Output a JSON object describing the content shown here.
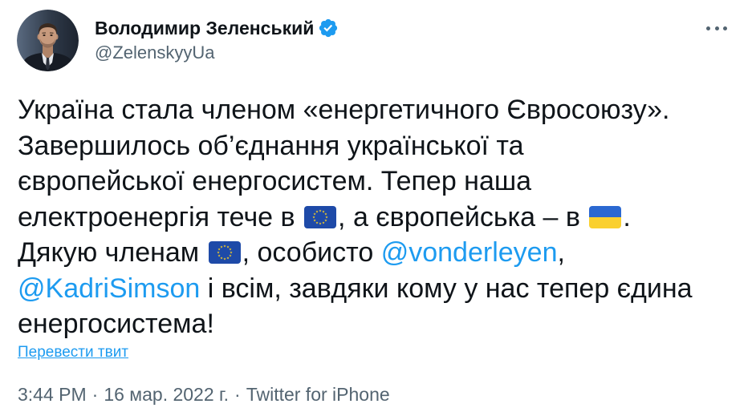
{
  "author": {
    "name": "Володимир Зеленський",
    "handle": "@ZelenskyyUa",
    "avatar_icon": "avatar-photo",
    "verified_icon": "verified-badge-icon"
  },
  "more_icon": "more-icon",
  "tweet": {
    "lines": [
      [
        {
          "text": "Україна стала членом «енергетичного Євросоюзу»."
        }
      ],
      [
        {
          "text": "Завершилось об’єднання української та"
        }
      ],
      [
        {
          "text": "європейської енергосистем. Тепер наша"
        }
      ],
      [
        {
          "text": "електроенергія тече в "
        },
        {
          "icon": "eu-flag-icon"
        },
        {
          "text": ", а європейська – в "
        },
        {
          "icon": "ukraine-flag-icon"
        },
        {
          "text": "."
        }
      ],
      [
        {
          "text": "Дякую членам "
        },
        {
          "icon": "eu-flag-icon"
        },
        {
          "text": ", особисто "
        },
        {
          "mention": "@vonderleyen"
        },
        {
          "text": ","
        }
      ],
      [
        {
          "mention": "@KadriSimson"
        },
        {
          "text": " і всім, завдяки кому у нас тепер єдина"
        }
      ],
      [
        {
          "text": "енергосистема!"
        }
      ]
    ]
  },
  "translate_link": "Перевести твит",
  "footer": {
    "time": "3:44 PM",
    "separator": "·",
    "date": "16 мар. 2022 г.",
    "source": "Twitter for iPhone"
  },
  "colors": {
    "text": "#0f1419",
    "secondary": "#536471",
    "link": "#1d9bf0",
    "verified": "#1d9bf0",
    "eu_flag": "#1e4aa8",
    "eu_stars": "#ffd21f",
    "ua_blue": "#2b68d1",
    "ua_yellow": "#fad02f"
  }
}
